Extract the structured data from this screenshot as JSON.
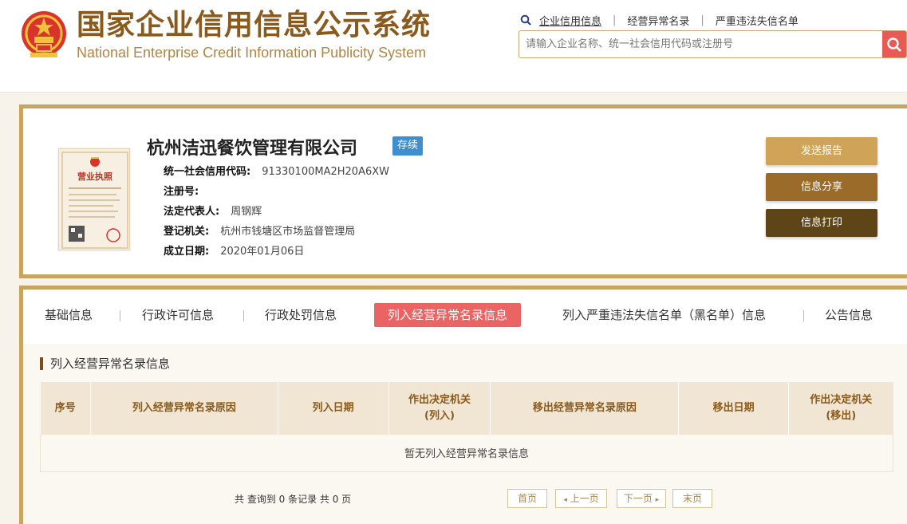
{
  "header": {
    "title_cn": "国家企业信用信息公示系统",
    "title_en": "National Enterprise Credit Information Publicity System",
    "links": [
      {
        "label": "企业信用信息"
      },
      {
        "label": "经营异常名录"
      },
      {
        "label": "严重违法失信名单"
      }
    ],
    "search": {
      "placeholder": "请输入企业名称、统一社会信用代码或注册号",
      "value": ""
    }
  },
  "company": {
    "name": "杭州洁迅餐饮管理有限公司",
    "status": "存续",
    "fields": [
      {
        "label": "统一社会信用代码:",
        "value": "91330100MA2H20A6XW"
      },
      {
        "label": "注册号:",
        "value": ""
      },
      {
        "label": "法定代表人:",
        "value": "周钢辉"
      },
      {
        "label": "登记机关:",
        "value": "杭州市钱塘区市场监督管理局"
      },
      {
        "label": "成立日期:",
        "value": "2020年01月06日"
      }
    ],
    "buttons": {
      "send": "发送报告",
      "share": "信息分享",
      "print": "信息打印"
    },
    "license_text": "营业执照"
  },
  "tabs": [
    {
      "label": "基础信息"
    },
    {
      "label": "行政许可信息"
    },
    {
      "label": "行政处罚信息"
    },
    {
      "label": "列入经营异常名录信息"
    },
    {
      "label": "列入严重违法失信名单（黑名单）信息"
    },
    {
      "label": "公告信息"
    }
  ],
  "section": {
    "title": "列入经营异常名录信息",
    "columns": [
      "序号",
      "列入经营异常名录原因",
      "列入日期",
      "作出决定机关\n(列入)",
      "移出经营异常名录原因",
      "移出日期",
      "作出决定机关\n(移出)"
    ],
    "empty_text": "暂无列入经营异常名录信息"
  },
  "pagination": {
    "info": "共 查询到 0 条记录 共 0 页",
    "first": "首页",
    "prev": "上一页",
    "next": "下一页",
    "last": "末页"
  },
  "colors": {
    "brand": "#8a5a1c",
    "border": "#c8a461",
    "active_tab": "#ea6464",
    "status_badge": "#3d8fd1"
  }
}
